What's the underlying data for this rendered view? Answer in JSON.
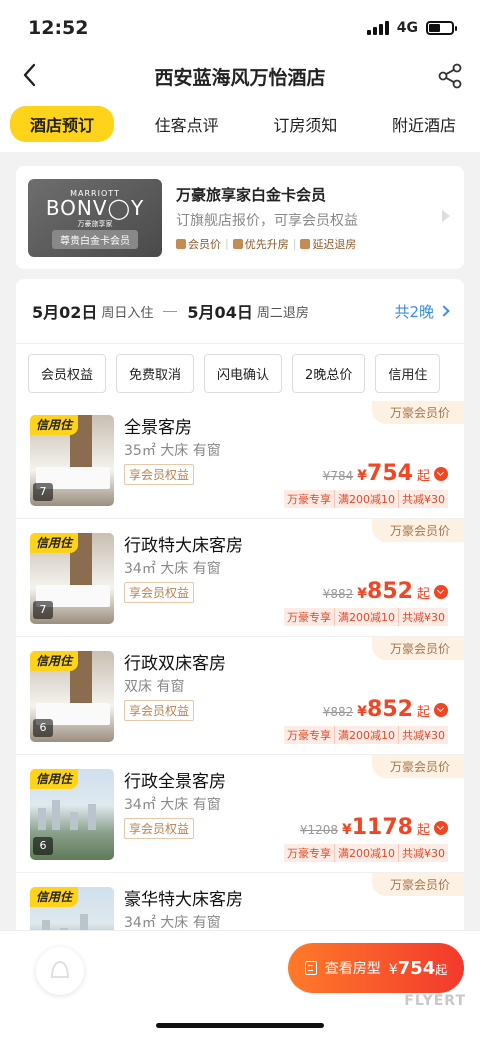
{
  "status": {
    "time": "12:52",
    "network": "4G"
  },
  "nav": {
    "title": "西安蓝海风万怡酒店"
  },
  "tabs": [
    {
      "label": "酒店预订",
      "active": true
    },
    {
      "label": "住客点评"
    },
    {
      "label": "订房须知"
    },
    {
      "label": "附近酒店"
    }
  ],
  "member": {
    "card": {
      "brand_top": "MARRIOTT",
      "brand": "BONV",
      "brand_end": "Y",
      "brand_sub": "万豪旅享家",
      "badge": "尊贵白金卡会员"
    },
    "title": "万豪旅享家白金卡会员",
    "subtitle": "订旗舰店报价，可享会员权益",
    "perks": [
      "会员价",
      "优先升房",
      "延迟退房"
    ]
  },
  "dates": {
    "checkin_date": "5月02日",
    "checkin_label": "周日入住",
    "checkout_date": "5月04日",
    "checkout_label": "周二退房",
    "nights": "共2晚"
  },
  "filters": [
    "会员权益",
    "免费取消",
    "闪电确认",
    "2晚总价",
    "信用住"
  ],
  "rooms": [
    {
      "credit": "信用住",
      "photos": "7",
      "name": "全景客房",
      "spec": "35㎡ 大床 有窗",
      "member_tag": "享会员权益",
      "brand_tag": "万豪会员价",
      "old_price": "¥784",
      "currency": "¥",
      "price": "754",
      "suffix": "起",
      "promos": [
        "万豪专享",
        "满200减10",
        "共减¥30"
      ]
    },
    {
      "credit": "信用住",
      "photos": "7",
      "name": "行政特大床客房",
      "spec": "34㎡ 大床 有窗",
      "member_tag": "享会员权益",
      "brand_tag": "万豪会员价",
      "old_price": "¥882",
      "currency": "¥",
      "price": "852",
      "suffix": "起",
      "promos": [
        "万豪专享",
        "满200减10",
        "共减¥30"
      ]
    },
    {
      "credit": "信用住",
      "photos": "6",
      "name": "行政双床客房",
      "spec": "双床 有窗",
      "member_tag": "享会员权益",
      "brand_tag": "万豪会员价",
      "old_price": "¥882",
      "currency": "¥",
      "price": "852",
      "suffix": "起",
      "promos": [
        "万豪专享",
        "满200减10",
        "共减¥30"
      ]
    },
    {
      "credit": "信用住",
      "photos": "6",
      "name": "行政全景客房",
      "spec": "34㎡ 大床 有窗",
      "member_tag": "享会员权益",
      "brand_tag": "万豪会员价",
      "old_price": "¥1208",
      "currency": "¥",
      "price": "1178",
      "suffix": "起",
      "promos": [
        "万豪专享",
        "满200减10",
        "共减¥30"
      ]
    },
    {
      "credit": "信用住",
      "photos": "",
      "name": "豪华特大床客房",
      "spec": "34㎡ 大床 有窗",
      "member_tag": "",
      "brand_tag": "万豪会员价",
      "old_price": "",
      "currency": "",
      "price": "",
      "suffix": "",
      "promos": []
    }
  ],
  "bottom": {
    "cta_label": "查看房型",
    "cta_currency": "¥",
    "cta_price": "754",
    "cta_suffix": "起",
    "watermark": "FLYERT"
  },
  "colors": {
    "accent_yellow": "#ffd31a",
    "price_red": "#f04623",
    "link_blue": "#3a8ee6",
    "gold": "#a8764a"
  }
}
